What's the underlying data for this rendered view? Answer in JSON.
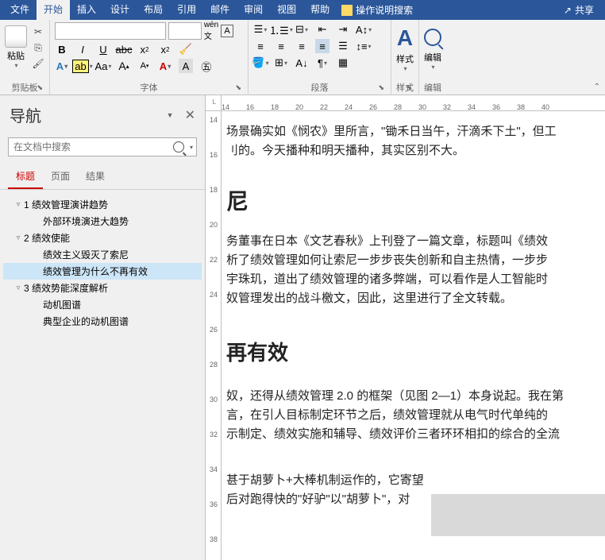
{
  "tabs": {
    "file": "文件",
    "home": "开始",
    "insert": "插入",
    "design": "设计",
    "layout": "布局",
    "ref": "引用",
    "mail": "邮件",
    "review": "审阅",
    "view": "视图",
    "help": "帮助",
    "tellme": "操作说明搜索",
    "share": "共享"
  },
  "groups": {
    "clipboard": "剪贴板",
    "font": "字体",
    "paragraph": "段落",
    "styles": "样式",
    "editing": "编辑"
  },
  "paste": "粘贴",
  "style": "样式",
  "edit": "编辑",
  "nav": {
    "title": "导航",
    "placeholder": "在文档中搜索",
    "tabs": {
      "h": "标题",
      "p": "页面",
      "r": "结果"
    },
    "items": [
      {
        "lvl": 0,
        "arrow": "▿",
        "text": "1 绩效管理演讲趋势"
      },
      {
        "lvl": 1,
        "arrow": "",
        "text": "外部环境演进大趋势"
      },
      {
        "lvl": 0,
        "arrow": "▿",
        "text": "2 绩效使能"
      },
      {
        "lvl": 1,
        "arrow": "",
        "text": "绩效主义毁灭了索尼"
      },
      {
        "lvl": 1,
        "arrow": "",
        "text": "绩效管理为什么不再有效",
        "sel": true
      },
      {
        "lvl": 0,
        "arrow": "▿",
        "text": "3 绩效势能深度解析"
      },
      {
        "lvl": 1,
        "arrow": "",
        "text": "动机图谱"
      },
      {
        "lvl": 1,
        "arrow": "",
        "text": "典型企业的动机图谱"
      }
    ]
  },
  "ruler_h": [
    "14",
    "16",
    "18",
    "20",
    "22",
    "24",
    "26",
    "28",
    "30",
    "32",
    "34",
    "36",
    "38",
    "40"
  ],
  "ruler_v": [
    "14",
    "16",
    "18",
    "20",
    "22",
    "24",
    "26",
    "28",
    "30",
    "32",
    "34",
    "36",
    "38"
  ],
  "doc": {
    "p1": "场景确实如《悯农》里所言，\"锄禾日当午，汗滴禾下土\"，但工",
    "p2": "刂的。今天播种和明天播种，其实区别不大。",
    "h1": "尼",
    "p3": "务董事在日本《文艺春秋》上刊登了一篇文章，标题叫《绩效",
    "p4": "析了绩效管理如何让索尼一步步丧失创新和自主热情，一步步",
    "p5": "宇珠玑，道出了绩效管理的诸多弊端，可以看作是人工智能时",
    "p6": "奴管理发出的战斗檄文，因此，这里进行了全文转载。",
    "h2": "再有效",
    "p7": "奴，还得从绩效管理 2.0 的框架（见图 2—1）本身说起。我在第",
    "p8": "言，在引人目标制定环节之后，绩效管理就从电气时代单纯的",
    "p9": "示制定、绩效实施和辅导、绩效评价三者环环相扣的综合的全流",
    "p10": "甚于胡萝卜+大棒机制运作的，它寄望",
    "p11": "后对跑得快的\"好驴\"以\"胡萝卜\"，对"
  }
}
